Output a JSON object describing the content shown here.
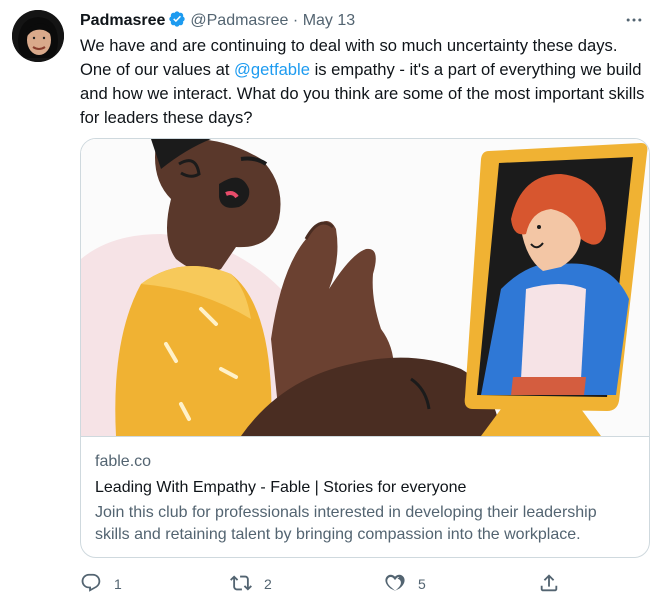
{
  "tweet": {
    "author_name": "Padmasree",
    "author_handle": "@Padmasree",
    "separator": "·",
    "date": "May 13",
    "text_part1": "We have and are continuing to deal with so much uncertainty these days. One of our values at ",
    "mention": "@getfable",
    "text_part2": " is empathy - it's a part of everything we build and how we interact. What do you think are some of the most important skills for leaders these days?"
  },
  "card": {
    "domain": "fable.co",
    "title": "Leading With Empathy - Fable | Stories for everyone",
    "description": "Join this club for professionals interested in developing their leadership skills and retaining talent by bringing compassion into the workplace."
  },
  "actions": {
    "reply_count": "1",
    "retweet_count": "2",
    "like_count": "5"
  },
  "colors": {
    "accent": "#1d9bf0",
    "muted_text": "#536471",
    "border": "#cfd9de"
  },
  "icons": [
    "verified-badge-icon",
    "more-icon",
    "reply-icon",
    "retweet-icon",
    "like-icon",
    "share-icon"
  ]
}
